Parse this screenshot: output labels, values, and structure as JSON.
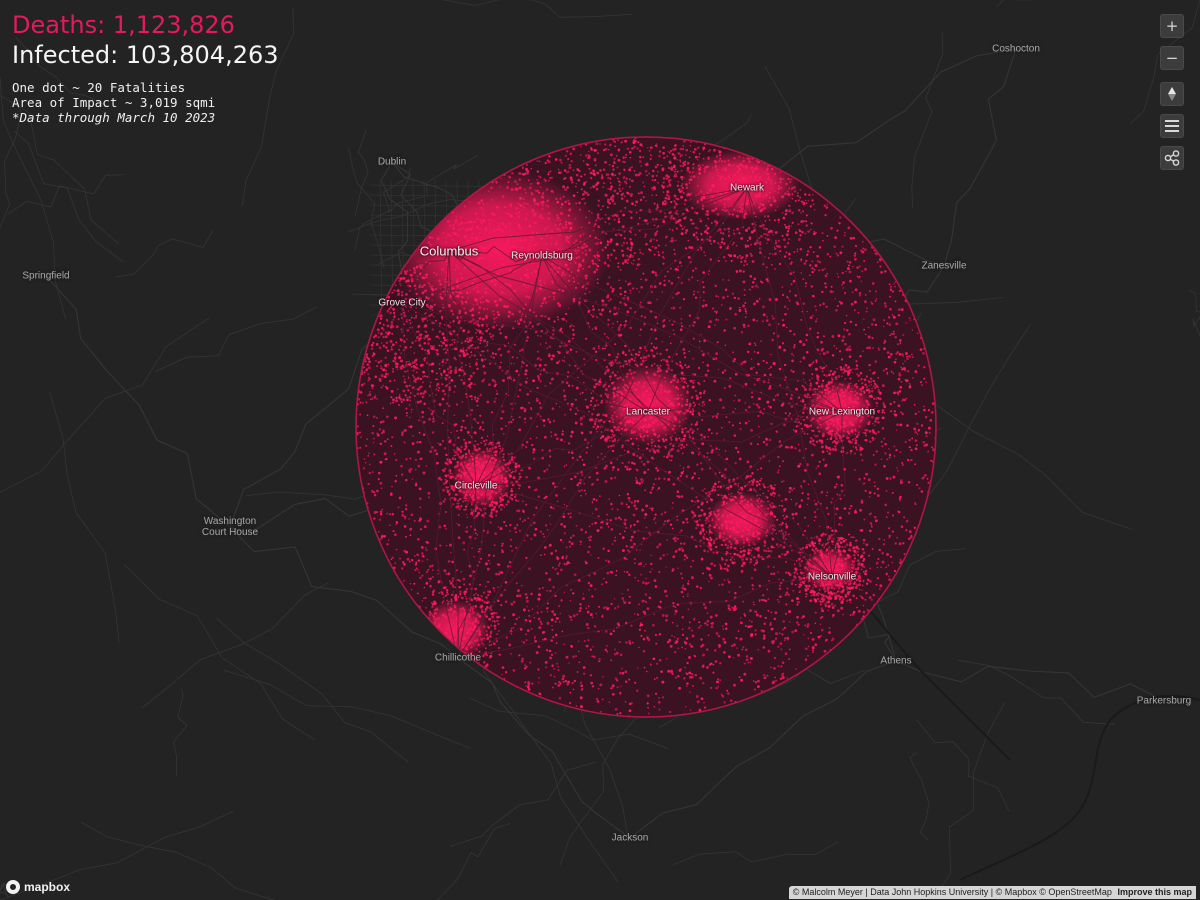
{
  "stats": {
    "deaths": "Deaths: 1,123,826",
    "infected": "Infected: 103,804,263"
  },
  "legend": {
    "dot": "One dot ~ 20 Fatalities",
    "area": "Area of Impact ~ 3,019 sqmi",
    "note": "*Data through March 10 2023"
  },
  "places": {
    "coshocton": "Coshocton",
    "dublin": "Dublin",
    "columbus": "Columbus",
    "reynoldsburg": "Reynoldsburg",
    "newark": "Newark",
    "zanesville": "Zanesville",
    "springfield": "Springfield",
    "grove_city": "Grove City",
    "lancaster": "Lancaster",
    "new_lexington": "New Lexington",
    "circleville": "Circleville",
    "washington_court_house": "Washington\nCourt House",
    "nelsonville": "Nelsonville",
    "chillicothe": "Chillicothe",
    "athens": "Athens",
    "parkersburg": "Parkersburg",
    "jackson": "Jackson"
  },
  "controls": {
    "zoom_in": "+",
    "zoom_out": "−"
  },
  "logo": "mapbox",
  "attribution": {
    "text": "© Malcolm Meyer | Data John Hopkins University | © Mapbox © OpenStreetMap",
    "improve": "Improve this map"
  },
  "colors": {
    "background": "#232323",
    "dot": "#ff1a5e",
    "deaths": "#e5195f",
    "roads": "#353535"
  },
  "icons": {
    "compass": "compass-icon",
    "menu": "menu-icon",
    "share": "share-icon",
    "logo": "mapbox-logo-icon"
  }
}
